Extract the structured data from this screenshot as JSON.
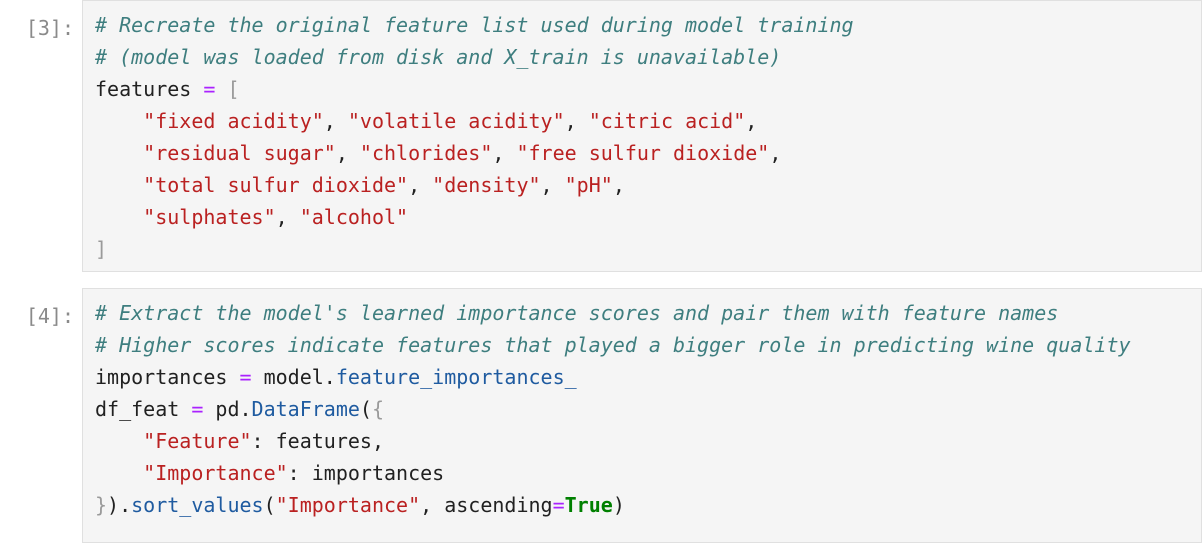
{
  "cells": [
    {
      "prompt": "[3]:",
      "lines": [
        [
          {
            "t": "c",
            "v": "# Recreate the original feature list used during model training"
          }
        ],
        [
          {
            "t": "c",
            "v": "# (model was loaded from disk and X_train is unavailable)"
          }
        ],
        [
          {
            "t": "p",
            "v": "features "
          },
          {
            "t": "o",
            "v": "="
          },
          {
            "t": "p",
            "v": " "
          },
          {
            "t": "b",
            "v": "["
          }
        ],
        [
          {
            "t": "p",
            "v": "    "
          },
          {
            "t": "s",
            "v": "\"fixed acidity\""
          },
          {
            "t": "p",
            "v": ", "
          },
          {
            "t": "s",
            "v": "\"volatile acidity\""
          },
          {
            "t": "p",
            "v": ", "
          },
          {
            "t": "s",
            "v": "\"citric acid\""
          },
          {
            "t": "p",
            "v": ","
          }
        ],
        [
          {
            "t": "p",
            "v": "    "
          },
          {
            "t": "s",
            "v": "\"residual sugar\""
          },
          {
            "t": "p",
            "v": ", "
          },
          {
            "t": "s",
            "v": "\"chlorides\""
          },
          {
            "t": "p",
            "v": ", "
          },
          {
            "t": "s",
            "v": "\"free sulfur dioxide\""
          },
          {
            "t": "p",
            "v": ","
          }
        ],
        [
          {
            "t": "p",
            "v": "    "
          },
          {
            "t": "s",
            "v": "\"total sulfur dioxide\""
          },
          {
            "t": "p",
            "v": ", "
          },
          {
            "t": "s",
            "v": "\"density\""
          },
          {
            "t": "p",
            "v": ", "
          },
          {
            "t": "s",
            "v": "\"pH\""
          },
          {
            "t": "p",
            "v": ","
          }
        ],
        [
          {
            "t": "p",
            "v": "    "
          },
          {
            "t": "s",
            "v": "\"sulphates\""
          },
          {
            "t": "p",
            "v": ", "
          },
          {
            "t": "s",
            "v": "\"alcohol\""
          }
        ],
        [
          {
            "t": "b",
            "v": "]"
          }
        ]
      ]
    },
    {
      "prompt": "[4]:",
      "lines": [
        [
          {
            "t": "c",
            "v": "# Extract the model's learned importance scores and pair them with feature names"
          }
        ],
        [
          {
            "t": "c",
            "v": "# Higher scores indicate features that played a bigger role in predicting wine quality"
          }
        ],
        [
          {
            "t": "p",
            "v": "importances "
          },
          {
            "t": "o",
            "v": "="
          },
          {
            "t": "p",
            "v": " model."
          },
          {
            "t": "a",
            "v": "feature_importances_"
          }
        ],
        [
          {
            "t": "p",
            "v": "df_feat "
          },
          {
            "t": "o",
            "v": "="
          },
          {
            "t": "p",
            "v": " pd."
          },
          {
            "t": "a",
            "v": "DataFrame"
          },
          {
            "t": "p",
            "v": "("
          },
          {
            "t": "b",
            "v": "{"
          }
        ],
        [
          {
            "t": "p",
            "v": "    "
          },
          {
            "t": "s",
            "v": "\"Feature\""
          },
          {
            "t": "p",
            "v": ": features,"
          }
        ],
        [
          {
            "t": "p",
            "v": "    "
          },
          {
            "t": "s",
            "v": "\"Importance\""
          },
          {
            "t": "p",
            "v": ": importances"
          }
        ],
        [
          {
            "t": "b",
            "v": "}"
          },
          {
            "t": "p",
            "v": ")."
          },
          {
            "t": "a",
            "v": "sort_values"
          },
          {
            "t": "p",
            "v": "("
          },
          {
            "t": "s",
            "v": "\"Importance\""
          },
          {
            "t": "p",
            "v": ", ascending"
          },
          {
            "t": "o",
            "v": "="
          },
          {
            "t": "k",
            "v": "True"
          },
          {
            "t": "p",
            "v": ")"
          }
        ]
      ]
    }
  ]
}
